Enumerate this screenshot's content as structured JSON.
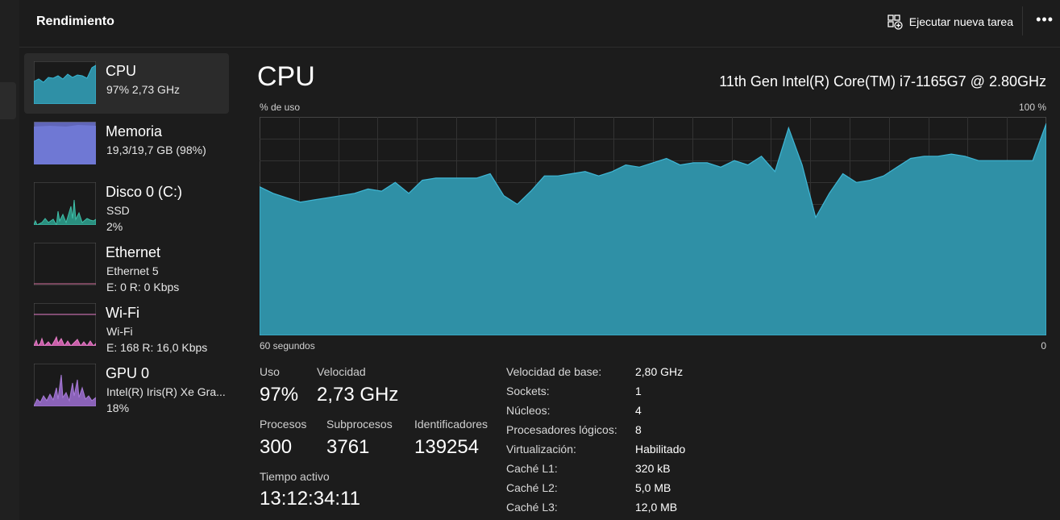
{
  "header": {
    "title": "Rendimiento",
    "run_task_label": "Ejecutar nueva tarea",
    "more_label": "•••"
  },
  "sidebar": {
    "items": [
      {
        "name": "CPU",
        "sub1": "97%  2,73 GHz",
        "sub2": "",
        "color": "#38a8c3"
      },
      {
        "name": "Memoria",
        "sub1": "19,3/19,7 GB (98%)",
        "sub2": "",
        "color": "#8b93e6"
      },
      {
        "name": "Disco 0 (C:)",
        "sub1": "SSD",
        "sub2": "2%",
        "color": "#3fbfa8"
      },
      {
        "name": "Ethernet",
        "sub1": "Ethernet 5",
        "sub2": "E: 0 R: 0 Kbps",
        "color": "#d4709d"
      },
      {
        "name": "Wi-Fi",
        "sub1": "Wi-Fi",
        "sub2": "E: 168 R: 16,0 Kbps",
        "color": "#e67ec8"
      },
      {
        "name": "GPU 0",
        "sub1": "Intel(R) Iris(R) Xe Gra...",
        "sub2": "18%",
        "color": "#a77ad6"
      }
    ]
  },
  "main": {
    "title": "CPU",
    "model": "11th Gen Intel(R) Core(TM) i7-1165G7 @ 2.80GHz",
    "y_label": "% de uso",
    "y_max_label": "100 %",
    "x_left_label": "60 segundos",
    "x_right_label": "0"
  },
  "stats": {
    "uso_label": "Uso",
    "uso_value": "97%",
    "velocidad_label": "Velocidad",
    "velocidad_value": "2,73 GHz",
    "procesos_label": "Procesos",
    "procesos_value": "300",
    "subprocesos_label": "Subprocesos",
    "subprocesos_value": "3761",
    "identificadores_label": "Identificadores",
    "identificadores_value": "139254",
    "tiempo_label": "Tiempo activo",
    "tiempo_value": "13:12:34:11"
  },
  "details": [
    {
      "label": "Velocidad de base:",
      "value": "2,80 GHz"
    },
    {
      "label": "Sockets:",
      "value": "1"
    },
    {
      "label": "Núcleos:",
      "value": "4"
    },
    {
      "label": "Procesadores lógicos:",
      "value": "8"
    },
    {
      "label": "Virtualización:",
      "value": "Habilitado"
    },
    {
      "label": "Caché L1:",
      "value": "320 kB"
    },
    {
      "label": "Caché L2:",
      "value": "5,0 MB"
    },
    {
      "label": "Caché L3:",
      "value": "12,0 MB"
    }
  ],
  "chart_data": {
    "type": "area",
    "x_range": [
      60,
      0
    ],
    "ylim": [
      0,
      100
    ],
    "grid": true,
    "color": "#2f90a6",
    "values": [
      68,
      65,
      63,
      61,
      62,
      63,
      64,
      65,
      67,
      66,
      70,
      65,
      71,
      72,
      72,
      72,
      72,
      74,
      64,
      60,
      66,
      73,
      73,
      74,
      75,
      73,
      75,
      78,
      77,
      79,
      81,
      78,
      79,
      79,
      77,
      80,
      78,
      82,
      75,
      95,
      78,
      54,
      65,
      74,
      70,
      71,
      73,
      77,
      81,
      82,
      82,
      83,
      82,
      80,
      80,
      80,
      80,
      80,
      97
    ]
  }
}
